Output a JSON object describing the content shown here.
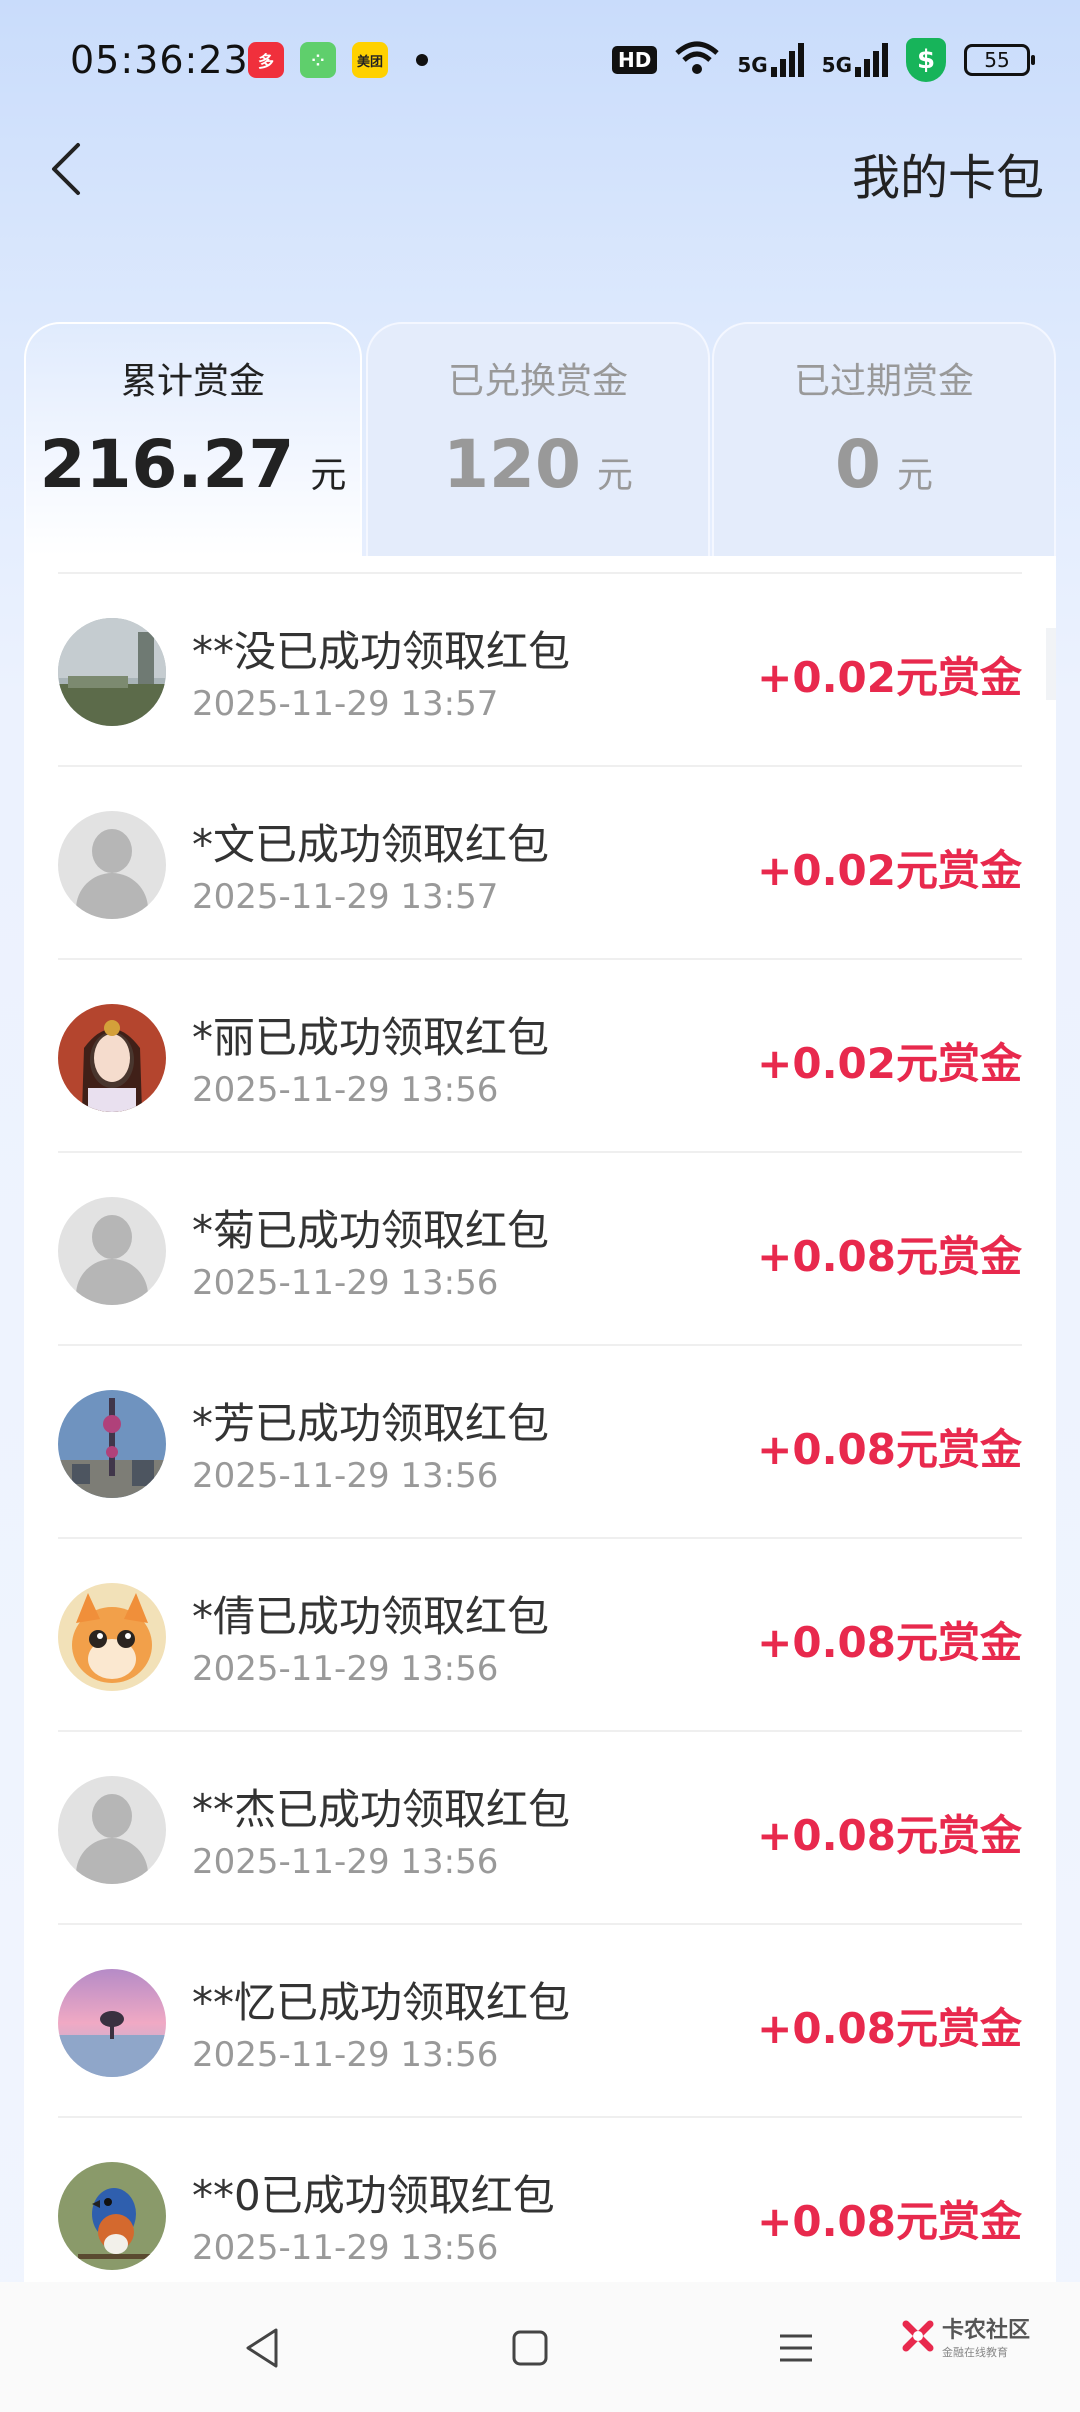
{
  "status_bar": {
    "time": "05:36:23",
    "meituan_label": "美团",
    "hd_label": "HD",
    "net1": "5G",
    "net2": "5G",
    "battery": "55",
    "shield_symbol": "$"
  },
  "header": {
    "title": "我的卡包",
    "back_icon": "chevron-left-icon"
  },
  "tabs": [
    {
      "label": "累计赏金",
      "amount": "216.27",
      "unit": "元",
      "active": true
    },
    {
      "label": "已兑换赏金",
      "amount": "120",
      "unit": "元",
      "active": false
    },
    {
      "label": "已过期赏金",
      "amount": "0",
      "unit": "元",
      "active": false
    }
  ],
  "records": [
    {
      "title": "**没已成功领取红包",
      "time": "2025-11-29 13:57",
      "amount": "+0.02元赏金",
      "avatar": "landscape-photo"
    },
    {
      "title": "*文已成功领取红包",
      "time": "2025-11-29 13:57",
      "amount": "+0.02元赏金",
      "avatar": "default"
    },
    {
      "title": "*丽已成功领取红包",
      "time": "2025-11-29 13:56",
      "amount": "+0.02元赏金",
      "avatar": "portrait-photo"
    },
    {
      "title": "*菊已成功领取红包",
      "time": "2025-11-29 13:56",
      "amount": "+0.08元赏金",
      "avatar": "default"
    },
    {
      "title": "*芳已成功领取红包",
      "time": "2025-11-29 13:56",
      "amount": "+0.08元赏金",
      "avatar": "tower-photo"
    },
    {
      "title": "*倩已成功领取红包",
      "time": "2025-11-29 13:56",
      "amount": "+0.08元赏金",
      "avatar": "kitten-photo"
    },
    {
      "title": "**杰已成功领取红包",
      "time": "2025-11-29 13:56",
      "amount": "+0.08元赏金",
      "avatar": "default"
    },
    {
      "title": "**忆已成功领取红包",
      "time": "2025-11-29 13:56",
      "amount": "+0.08元赏金",
      "avatar": "sunset-photo"
    },
    {
      "title": "**0已成功领取红包",
      "time": "2025-11-29 13:56",
      "amount": "+0.08元赏金",
      "avatar": "bird-photo"
    }
  ],
  "watermark": {
    "title": "卡农社区",
    "subtitle": "金融在线教育"
  },
  "colors": {
    "accent_red": "#e8294d",
    "muted": "#999999"
  }
}
